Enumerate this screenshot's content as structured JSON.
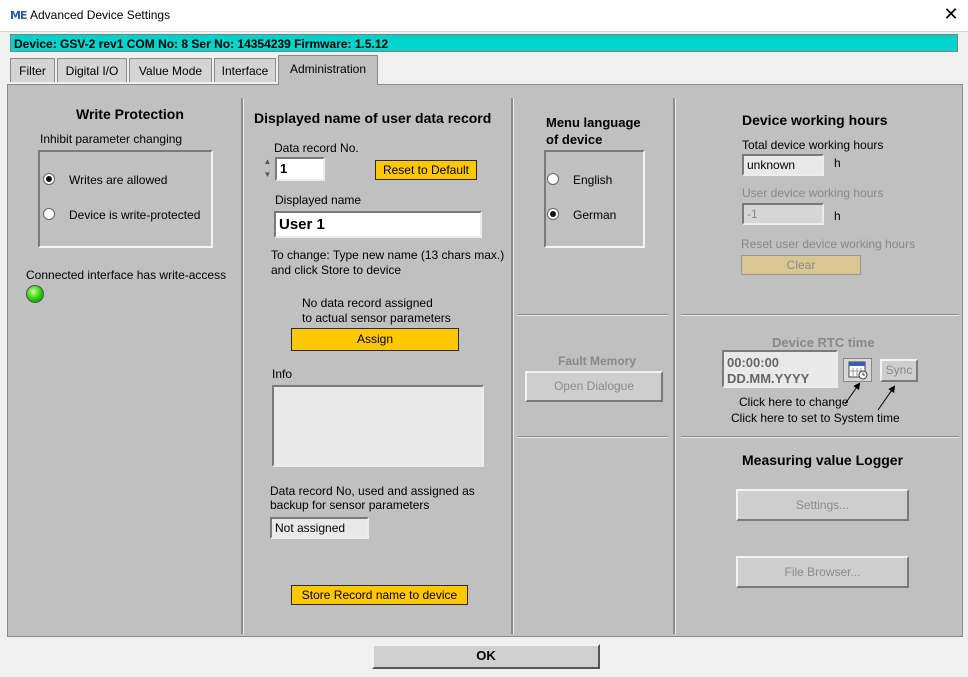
{
  "window": {
    "logo": "ME",
    "title": "Advanced Device Settings"
  },
  "device_bar": "Device: GSV-2 rev1 COM No: 8 Ser No: 14354239 Firmware: 1.5.12",
  "tabs": [
    "Filter",
    "Digital I/O",
    "Value Mode",
    "Interface",
    "Administration"
  ],
  "write_protection": {
    "title": "Write Protection",
    "subtitle": "Inhibit parameter changing",
    "options": [
      "Writes are allowed",
      "Device is write-protected"
    ],
    "selected": 0,
    "access_label": "Connected interface has write-access",
    "led_color": "#22cc00"
  },
  "user_record": {
    "title": "Displayed name of user data record",
    "record_no_label": "Data record No.",
    "record_no": "1",
    "reset_button": "Reset to Default",
    "name_label": "Displayed name",
    "name_value": "User 1",
    "hint_line1": "To change: Type new name (13 chars max.)",
    "hint_line2": "and click Store to device",
    "assign_note1": "No data record assigned",
    "assign_note2": "to actual sensor parameters",
    "assign_button": "Assign",
    "info_label": "Info",
    "info_value": "",
    "backup_line1": "Data record No, used and assigned as",
    "backup_line2": "backup for sensor parameters",
    "backup_value": "Not assigned",
    "store_button": "Store Record name to device"
  },
  "language": {
    "title_line1": "Menu language",
    "title_line2": "of device",
    "options": [
      "English",
      "German"
    ],
    "selected": 1
  },
  "fault_memory": {
    "title": "Fault Memory",
    "button": "Open Dialogue"
  },
  "working_hours": {
    "title": "Device working hours",
    "total_label": "Total device working hours",
    "total_value": "unknown",
    "unit": "h",
    "user_label": "User device working hours",
    "user_value": "-1",
    "reset_label": "Reset user device working hours",
    "clear_button": "Clear"
  },
  "rtc": {
    "title": "Device RTC time",
    "time": "00:00:00",
    "date": "DD.MM.YYYY",
    "sync_button": "Sync",
    "note_change": "Click here to change",
    "note_system": "Click here to set to System time"
  },
  "logger": {
    "title": "Measuring value Logger",
    "settings_button": "Settings...",
    "browser_button": "File Browser..."
  },
  "ok_button": "OK",
  "colors": {
    "accent_bar": "#00d2cc",
    "button_yellow": "#ffc700",
    "clear_button": "#d9c690",
    "panel": "#c0c0c0"
  }
}
